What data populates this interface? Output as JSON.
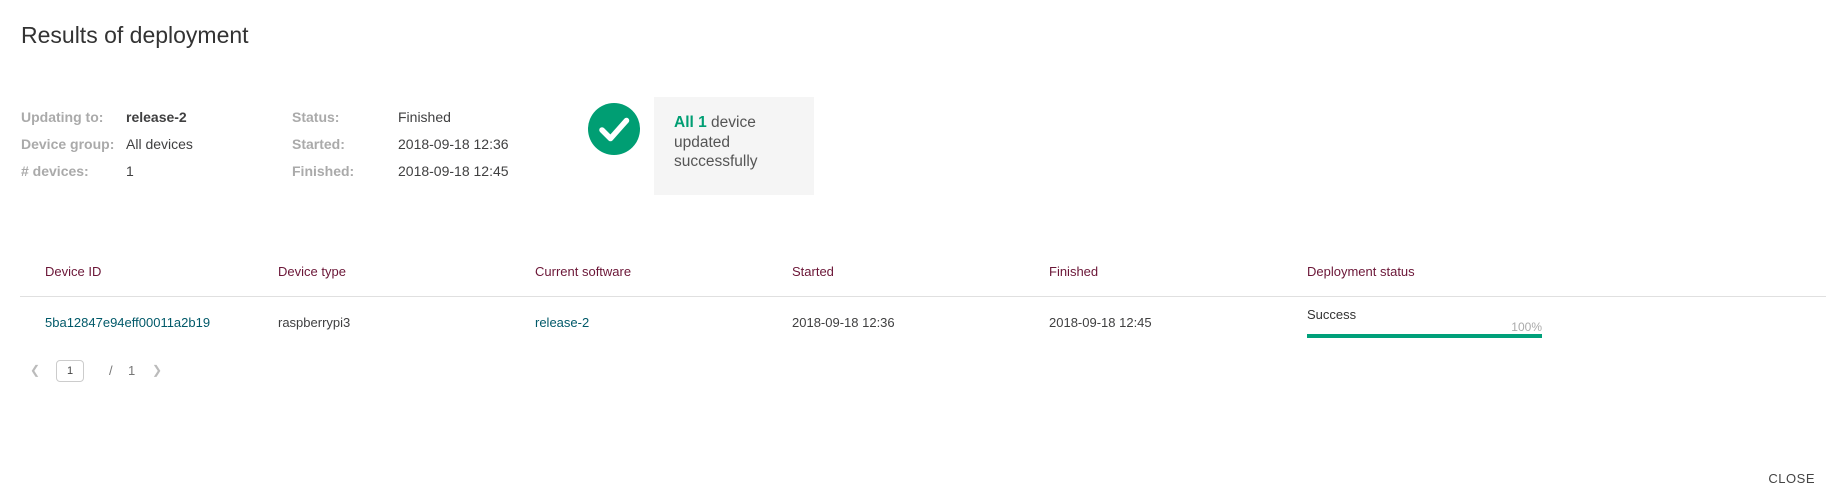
{
  "dialog": {
    "title": "Results of deployment",
    "close_label": "CLOSE"
  },
  "details": {
    "updating_to_label": "Updating to:",
    "updating_to_value": "release-2",
    "device_group_label": "Device group:",
    "device_group_value": "All devices",
    "devices_label": "# devices:",
    "devices_value": "1",
    "status_label": "Status:",
    "status_value": "Finished",
    "started_label": "Started:",
    "started_value": "2018-09-18 12:36",
    "finished_label": "Finished:",
    "finished_value": "2018-09-18 12:45"
  },
  "summary": {
    "icon": "check-circle-icon",
    "highlight": "All 1",
    "line1_rest": " device",
    "line2": "updated",
    "line3": "successfully",
    "color": "#009e73"
  },
  "table": {
    "headers": [
      "Device ID",
      "Device type",
      "Current software",
      "Started",
      "Finished",
      "Deployment status"
    ],
    "rows": [
      {
        "device_id": "5ba12847e94eff00011a2b19",
        "device_type": "raspberrypi3",
        "current_software": "release-2",
        "started": "2018-09-18 12:36",
        "finished": "2018-09-18 12:45",
        "status": "Success",
        "progress_label": "100%",
        "progress": 1.0
      }
    ]
  },
  "pagination": {
    "current_page": "1",
    "separator": "/",
    "total_pages": "1",
    "prev_icon": "chevron-left-icon",
    "next_icon": "chevron-right-icon"
  },
  "colors": {
    "accent": "#009e73",
    "link": "#015969",
    "header_text": "#6b1637"
  }
}
